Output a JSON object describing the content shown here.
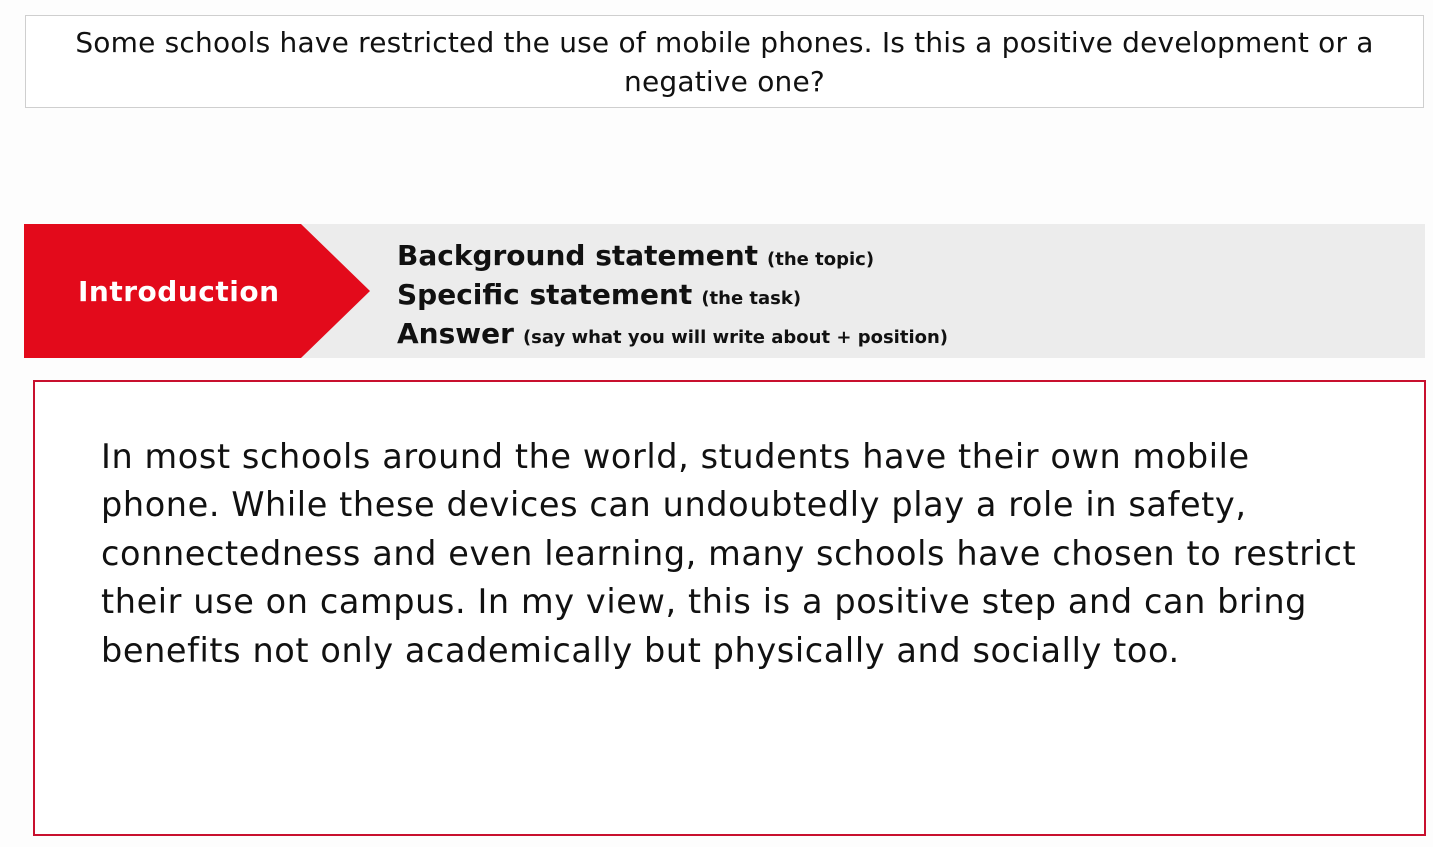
{
  "question": {
    "text": "Some schools have restricted the use of mobile phones. Is this a positive development or a negative one?"
  },
  "structure": {
    "section_label": "Introduction",
    "items": [
      {
        "title": "Background statement",
        "note": "(the topic)"
      },
      {
        "title": "Specific statement",
        "note": "(the task)"
      },
      {
        "title": "Answer",
        "note": "(say what you will write about + position)"
      }
    ]
  },
  "essay": {
    "paragraph": "In most schools around the world, students have their own mobile phone. While these devices can undoubtedly play a role in safety, connectedness and even learning, many schools have chosen to restrict their use on campus. In my view, this is a positive step and can bring benefits not only academically but physically and socially too."
  },
  "colors": {
    "accent_red": "#e30a1b",
    "band_grey": "#ececec",
    "essay_border": "#c8102e"
  }
}
